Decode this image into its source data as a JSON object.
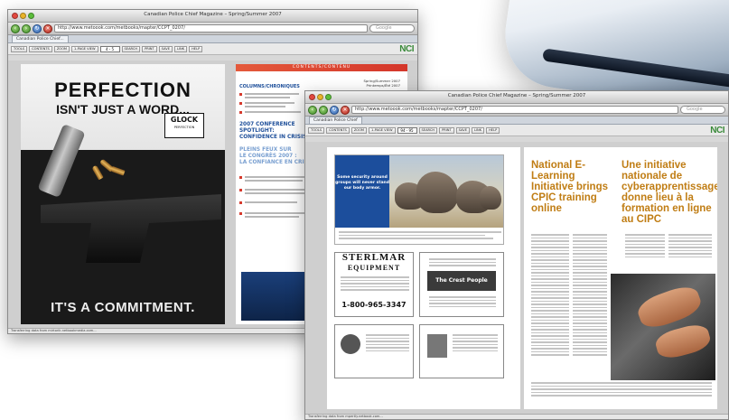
{
  "window_back": {
    "title": "Canadian Police Chief Magazine – Spring/Summer 2007",
    "url": "http://www.metoook.com/metbooks/mapter/CCPT_0207/",
    "search_placeholder": "Google",
    "tab": "Canadian Police Chief...",
    "toolbar": [
      "TOOLS",
      "CONTENTS",
      "ZOOM",
      "1-PAGE VIEW",
      "SEARCH",
      "PRINT",
      "SAVE",
      "LINK",
      "HELP"
    ],
    "page_field": "4 - 5",
    "logo": "NCI",
    "status": "Transferring data from mirtorik.netbookmedia.com..."
  },
  "window_front": {
    "title": "Canadian Police Chief Magazine – Spring/Summer 2007",
    "url": "http://www.metoook.com/metbooks/mapter/CCPT_0207/",
    "search_placeholder": "Google",
    "tab": "Canadian Police Chief",
    "toolbar": [
      "TOOLS",
      "CONTENTS",
      "ZOOM",
      "1-PAGE VIEW",
      "SEARCH",
      "PRINT",
      "SAVE",
      "LINK",
      "HELP"
    ],
    "page_field": "94 - 95",
    "logo": "NCI",
    "status": "Transferring data from mpertly.netbook.com..."
  },
  "glock_ad": {
    "headline": "PERFECTION",
    "subhead": "ISN'T JUST A WORD...",
    "brand": "GLOCK",
    "brand_tag": "PERFECTION",
    "tagline": "IT'S A COMMITMENT."
  },
  "contents_page": {
    "banner": "CONTENTS/CONTENU",
    "date_line1": "Spring/Summer 2007",
    "date_line2": "Printemps/Été 2007",
    "columns": "COLUMNS/CHRONIQUES",
    "conference": [
      "2007 CONFERENCE",
      "SPOTLIGHT:",
      "CONFIDENCE IN CRISIS"
    ],
    "french": [
      "PLEINS FEUX SUR",
      "LE CONGRÈS 2007 :",
      "LA CONFIANCE EN CRISE"
    ]
  },
  "spread": {
    "rhino_text": "Some security around groups will never stand our body armor.",
    "sterling_title": "STERLMAR",
    "sterling_sub": "EQUIPMENT",
    "sterling_phone": "1-800-965-3347",
    "crest_title": "The Crest People",
    "article_en": "National E-Learning Initiative brings CPIC training online",
    "article_fr": "Une initiative nationale de cyberapprentissage donne lieu à la formation en ligne au CIPC"
  }
}
